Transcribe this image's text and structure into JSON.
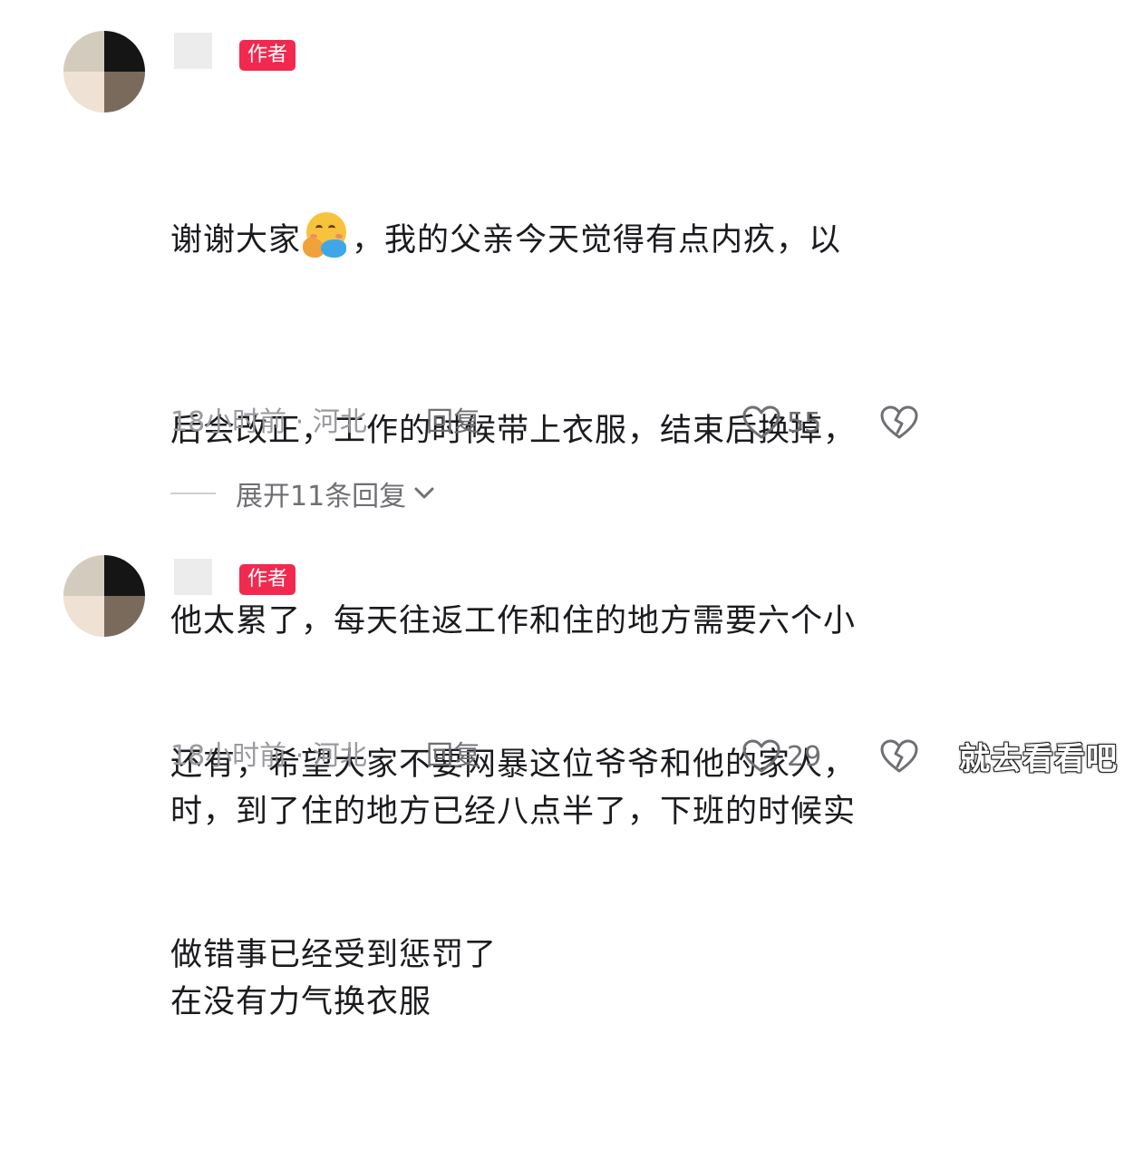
{
  "comments": [
    {
      "author_badge": "作者",
      "text_before_emoji": "谢谢大家",
      "emoji_name": "smiling-face-with-open-hands",
      "text_after_emoji": "，我的父亲今天觉得有点内疚，以",
      "text_lines": [
        "后会改正，工作的时候带上衣服，结束后换掉，",
        "他太累了，每天往返工作和住的地方需要六个小",
        "时，到了住的地方已经八点半了，下班的时候实",
        "在没有力气换衣服"
      ],
      "time_location": "18小时前 · 河北",
      "reply_label": "回复",
      "like_count": "55",
      "expand_replies_label": "展开11条回复"
    },
    {
      "author_badge": "作者",
      "text_lines": [
        "还有，希望大家不要网暴这位爷爷和他的家人，",
        "做错事已经受到惩罚了"
      ],
      "time_location": "18小时前 · 河北",
      "reply_label": "回复",
      "like_count": "29"
    }
  ],
  "watermark": "就去看看吧",
  "colors": {
    "badge": "#f2294f",
    "text": "#1b1b1f",
    "meta": "#9a9a9f",
    "action": "#6f6f74"
  },
  "icons": {
    "like": "heart-outline-icon",
    "dislike": "broken-heart-icon",
    "expand": "chevron-down-icon"
  }
}
